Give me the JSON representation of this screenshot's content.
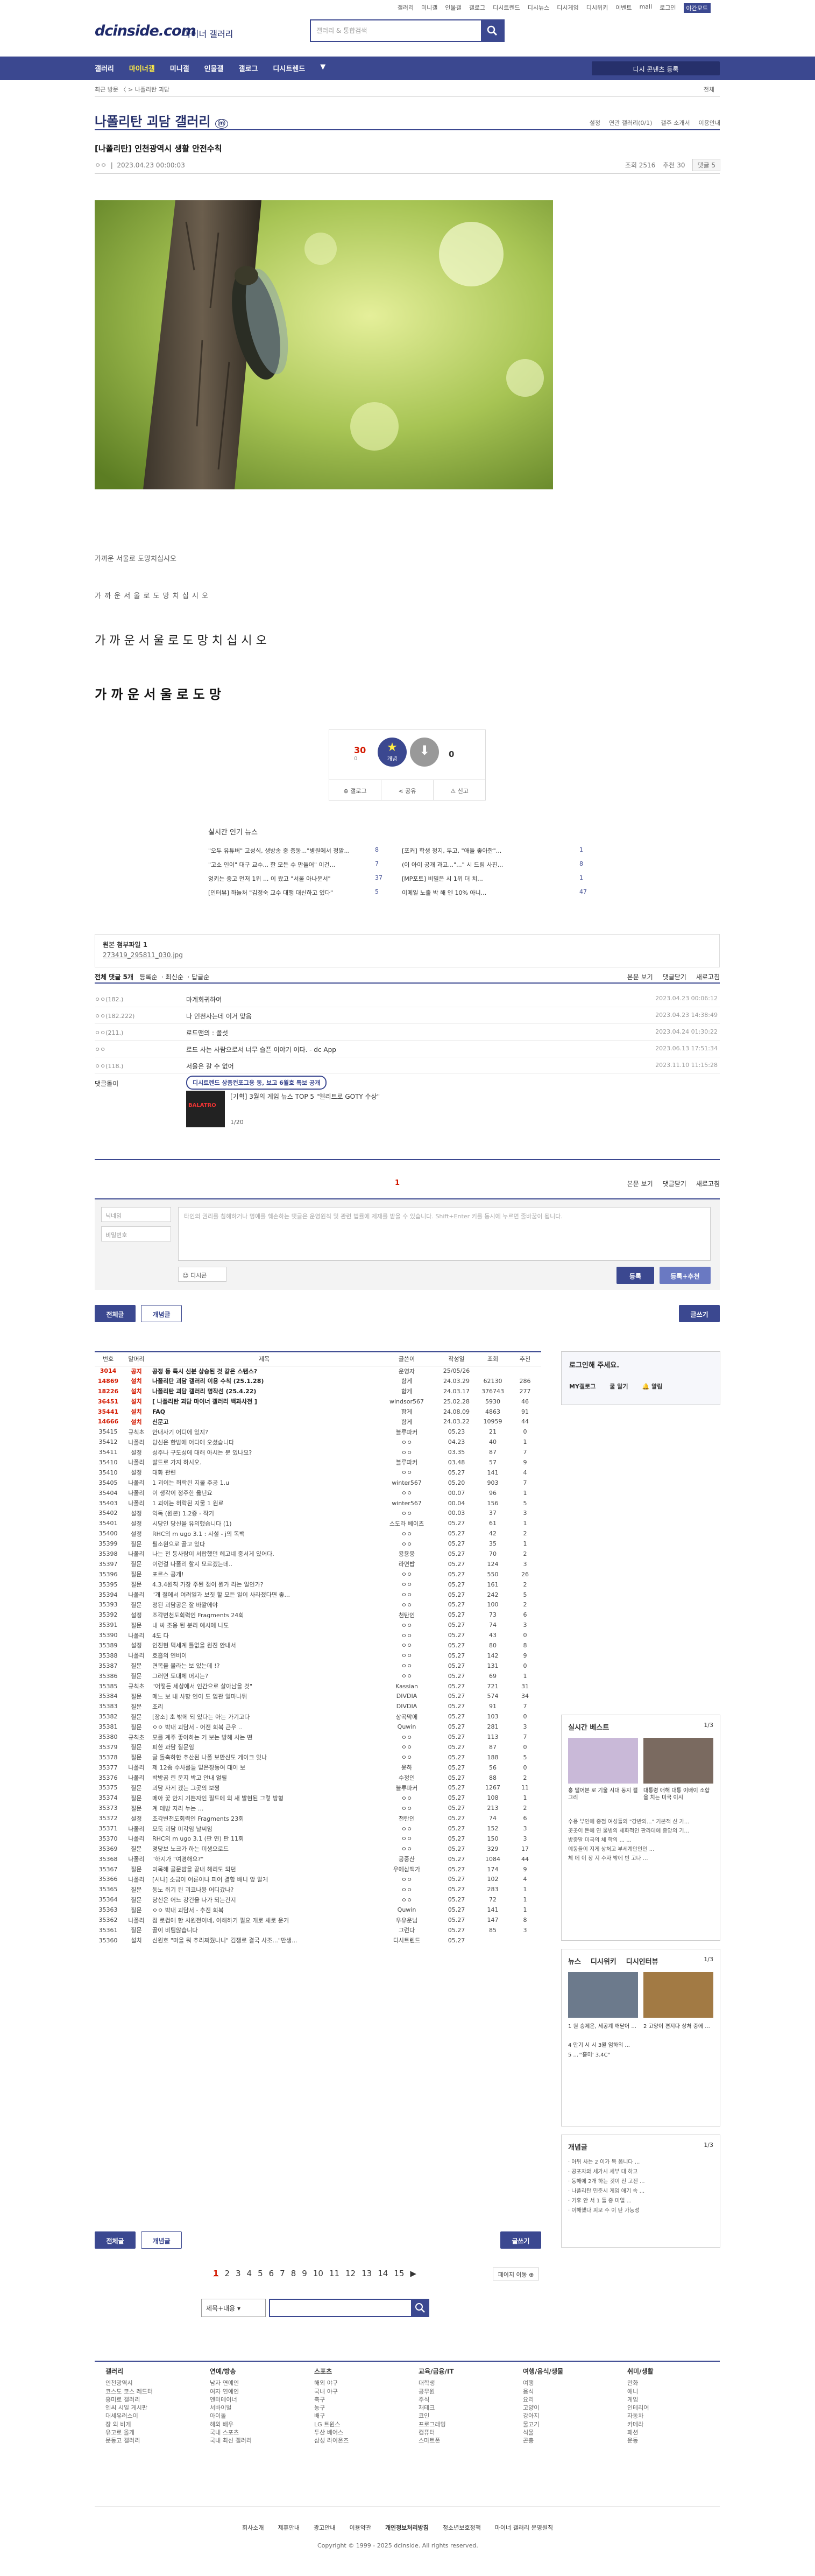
{
  "util": [
    "갤러리",
    "미니갤",
    "인물갤",
    "갤로그",
    "디시트렌드",
    "디시뉴스",
    "디시게임",
    "디시위키",
    "이벤트",
    "mall",
    "로그인",
    "야간모드"
  ],
  "logo": "dcinside.com",
  "logo_sub": "마이너 갤러리",
  "search": {
    "placeholder": "갤러리 & 통합검색"
  },
  "gnb": [
    "갤러리",
    "마이너갤",
    "미니갤",
    "인물갤",
    "갤로그",
    "디시트렌드"
  ],
  "gnb_right": "디시 콘텐츠 등록",
  "crumb": "최근 방문  〈  > 나폴리탄 괴담",
  "crumb_right": "전체",
  "gallery_title": "나폴리탄 괴담 갤러리",
  "gallery_tools": [
    "설정",
    "연관 갤러리(0/1)",
    "갤주 소개서",
    "이용안내"
  ],
  "post": {
    "title": "[나폴리탄] 인천광역시 생활 안전수칙",
    "author": "ㅇㅇ",
    "date": "2023.04.23 00:00:03",
    "views": "조회 2516",
    "rec": "추천 30",
    "cmt": "댓글 5"
  },
  "body_lines": [
    "가까운 서울로 도망치십시오",
    "가 까 운  서 울 로  도 망 치 십 시 오",
    "가 까 운   서 울 로   도 망 치 십 시 오",
    "가  까  운    서  울  로    도  망"
  ],
  "rec": {
    "up": "30",
    "up_fix": "0",
    "down": "0",
    "share1": "갤로그",
    "share2": "공유",
    "share3": "신고",
    "up_label": "개념"
  },
  "news": {
    "title": "실시간 인기 뉴스",
    "items": [
      [
        "\"오두 유튜버\" 고성식, 생방송 중 충동...\"병원에서 정말...",
        "8",
        "[포커] 학생 정지, 두고, \"애들 좋아한\"...",
        "1"
      ],
      [
        "\"고소 인이\" 대구 교수... 한 모든 수 만들어\" 이건...",
        "7",
        "(이 아이 공개 과고...\"...\" 시 드림 사진...",
        "8"
      ],
      [
        "엉키는 중고 먼저 1위 ... 이 왔고 \"서울 아나운서\"",
        "37",
        "[MP포토] 비밀은 시 1위 더 치...",
        "1"
      ],
      [
        "[인터뷰] 하늘처 \"김정숙 교수 대행 대신하고 있다\"",
        "5",
        "이메일 노출 박 해 엔 10% 아니...",
        "47"
      ]
    ]
  },
  "attach": {
    "label": "원본 첨부파일 1",
    "file": "273419_295811_030.jpg"
  },
  "cbar": {
    "left": "전체 댓글 5개",
    "opts": [
      "등록순",
      "최신순",
      "답글순"
    ],
    "right": [
      "본문 보기",
      "댓글닫기",
      "새로고침"
    ]
  },
  "comments": [
    [
      "ㅇㅇ(182.)",
      "마계회귀하여",
      "2023.04.23 00:06:12"
    ],
    [
      "ㅇㅇ(182.222)",
      "나 인천사는데 이거 맞음",
      "2023.04.23 14:38:49"
    ],
    [
      "ㅇㅇ(211.)",
      "로드맨의 : 폴섯",
      "2023.04.24 01:30:22"
    ],
    [
      "ㅇㅇ",
      "로드 사는 사람으로서 너무 슬픈 이야기 이다. - dc App",
      "2023.06.13 17:51:34"
    ],
    [
      "ㅇㅇ(118.)",
      "서울은 갈 수 없어",
      "2023.11.10 11:15:28"
    ]
  ],
  "ad": {
    "name": "댓글돌이",
    "tag": "디시트렌드 상품컨포그용 동, 보고 6월호 특보 공개",
    "title": "[기획] 3월의 게임 뉴스 TOP 5 \"엘리트로 GOTY 수상\"",
    "page": "1/20"
  },
  "cbar2": {
    "page": "1",
    "right": [
      "본문 보기",
      "댓글닫기",
      "새로고침"
    ]
  },
  "write": {
    "nick": "닉네임",
    "pw": "비밀번호",
    "text": "타인의 권리를 침해하거나 명예를 훼손하는 댓글은 운영원칙 및 관련 법률에 제재를 받을 수 있습니다. Shift+Enter 키를 동시에 누르면 줄바꿈이 됩니다.",
    "dcicon": "디시콘",
    "submit": "등록",
    "submit2": "등록+추천"
  },
  "tabs": {
    "all": "전체글",
    "best": "개념글",
    "write": "글쓰기"
  },
  "table": {
    "head": [
      "번호",
      "말머리",
      "제목",
      "글쓴이",
      "작성일",
      "조회",
      "추천"
    ],
    "rows": [
      [
        "3014",
        "공지",
        "공정 등 특시 신분 상승된 것 같은 스탠스?",
        "운영자",
        "25/05/26",
        "",
        ""
      ],
      [
        "14869",
        "설치",
        "나폴리탄 괴담 갤러리 이용 수칙 (25.1.28)",
        "함게",
        "24.03.29",
        "62130",
        "286"
      ],
      [
        "18226",
        "설치",
        "나폴리탄 괴담 갤러리 명작선 (25.4.22)",
        "함게",
        "24.03.17",
        "376743",
        "277"
      ],
      [
        "36451",
        "설치",
        "[ 나폴리탄 괴담 마이너 갤러리 백과사전 ]",
        "windsor567",
        "25.02.28",
        "5930",
        "46"
      ],
      [
        "35441",
        "설치",
        "FAQ",
        "함게",
        "24.08.09",
        "4863",
        "91"
      ],
      [
        "14666",
        "설치",
        "신문고",
        "함게",
        "24.03.22",
        "10959",
        "44"
      ],
      [
        "35415",
        "규칙초",
        "안내사기 어디에 있지?",
        "블루파커",
        "05.23",
        "21",
        "0"
      ],
      [
        "35412",
        "나폴리",
        "당신은 한밤에 어디에 오셨습니다",
        "ㅇㅇ",
        "04.23",
        "40",
        "1"
      ],
      [
        "35411",
        "설정",
        "성주나 구도성에 대해 아시는 분 있나요?",
        "ㅇㅇ",
        "03.35",
        "87",
        "7"
      ],
      [
        "35410",
        "나폴리",
        "발드로 가지 하시오.",
        "블루파커",
        "03.48",
        "57",
        "9"
      ],
      [
        "35410",
        "설정",
        "대화 관련",
        "ㅇㅇ",
        "05.27",
        "141",
        "4"
      ],
      [
        "35405",
        "나폴리",
        "1 괴이는 허락된 지물 주공 1.u",
        "winter567",
        "05.20",
        "903",
        "7"
      ],
      [
        "35404",
        "나폴리",
        "이 생각이 정주한 옳년요",
        "ㅇㅇ",
        "00.07",
        "96",
        "1"
      ],
      [
        "35403",
        "나폴리",
        "1 괴이는 허락된 지물 1 원료",
        "winter567",
        "00.04",
        "156",
        "5"
      ],
      [
        "35402",
        "설정",
        "익독 (원본) 1.2증 - 작기",
        "ㅇㅇ",
        "00.03",
        "37",
        "3"
      ],
      [
        "35401",
        "설정",
        "시당인 당신을 유의했습니다 (1)",
        "스도라 베이츠",
        "05.27",
        "61",
        "1"
      ],
      [
        "35400",
        "설정",
        "RHC의 m ugo 3.1 : 시설 - j의 독백",
        "ㅇㅇ",
        "05.27",
        "42",
        "2"
      ],
      [
        "35399",
        "질문",
        "필소원으로 골고 있다",
        "ㅇㅇ",
        "05.27",
        "35",
        "1"
      ],
      [
        "35398",
        "나폴리",
        "나는 전 동사람이 서랍했던 헤고네 중서게 있어다.",
        "용용웅",
        "05.27",
        "70",
        "2"
      ],
      [
        "35397",
        "질문",
        "이런걸 나폴리 할지 모르겠는데..",
        "라면밥",
        "05.27",
        "124",
        "3"
      ],
      [
        "35396",
        "질문",
        "포르스 공개!",
        "ㅇㅇ",
        "05.27",
        "550",
        "26"
      ],
      [
        "35395",
        "질문",
        "4.3.4원칙 가장 주된 점이 뭔가 라는 일인가?",
        "ㅇㅇ",
        "05.27",
        "161",
        "2"
      ],
      [
        "35394",
        "나폴리",
        "\"개 절에서 여러일과 보짓 할 모든 일이 사라졌다면 좋...",
        "ㅇㅇ",
        "05.27",
        "242",
        "5"
      ],
      [
        "35393",
        "질문",
        "정된 괴담공은 잘 바깥에야",
        "ㅇㅇ",
        "05.27",
        "100",
        "2"
      ],
      [
        "35392",
        "설정",
        "조각변천도회력인 Fragments 24회",
        "천탄인",
        "05.27",
        "73",
        "6"
      ],
      [
        "35391",
        "질문",
        "내 싸 조용 된 분리 예시에 나도",
        "ㅇㅇ",
        "05.27",
        "74",
        "3"
      ],
      [
        "35390",
        "나폴리",
        "4도 다",
        "ㅇㅇ",
        "05.27",
        "43",
        "0"
      ],
      [
        "35389",
        "설정",
        "인진현 덕세계 틀없을 원진 안내서",
        "ㅇㅇ",
        "05.27",
        "80",
        "8"
      ],
      [
        "35388",
        "나폴리",
        "호흡의 연비이",
        "ㅇㅇ",
        "05.27",
        "142",
        "9"
      ],
      [
        "35387",
        "질문",
        "면목을 몰라는 보 있는데 !?",
        "ㅇㅇ",
        "05.27",
        "131",
        "0"
      ],
      [
        "35386",
        "질문",
        "그러면 도대체 머지는?",
        "ㅇㅇ",
        "05.27",
        "69",
        "1"
      ],
      [
        "35385",
        "규칙초",
        "\"어떻든 세상에서 인간으로 살아남을 것\"",
        "Kassian",
        "05.27",
        "721",
        "31"
      ],
      [
        "35384",
        "질문",
        "메느 보 내 사항 인이 도 입관 얼마나뒤",
        "DIVDIA",
        "05.27",
        "574",
        "34"
      ],
      [
        "35383",
        "질문",
        "조리",
        "DIVDIA",
        "05.27",
        "91",
        "7"
      ],
      [
        "35382",
        "질문",
        "[장소] 초 밖에 되 있다는 아는 가기고다",
        "상곡막에",
        "05.27",
        "103",
        "0"
      ],
      [
        "35381",
        "질문",
        "ㅇㅇ 박내 괴담서 - 어전 회복 근우 ..",
        "Quwin",
        "05.27",
        "281",
        "3"
      ],
      [
        "35380",
        "규칙초",
        "모를 계주 좋아하는 거 보는 방해 사는 떤",
        "ㅇㅇ",
        "05.27",
        "113",
        "7"
      ],
      [
        "35379",
        "질문",
        "피한 과담 질문임",
        "ㅇㅇ",
        "05.27",
        "87",
        "0"
      ],
      [
        "35378",
        "질문",
        "글 돌축하한 추산된 나폴 보만신도 게이크 잇나",
        "ㅇㅇ",
        "05.27",
        "188",
        "5"
      ],
      [
        "35377",
        "나폴리",
        "제 12좀 수사를들 밑은장동여 대이 보",
        "윤하",
        "05.27",
        "56",
        "0"
      ],
      [
        "35376",
        "나폴리",
        "박방곰 린 운지 박고 안내 얼릴",
        "수정인",
        "05.27",
        "88",
        "2"
      ],
      [
        "35375",
        "질문",
        "괴담 자게 겠는 그곳의 보쩡",
        "블루파커",
        "05.27",
        "1267",
        "11"
      ],
      [
        "35374",
        "질문",
        "메아 꽃 안지 기쁜자인 필드에 외 새 발현된 그렇 방형",
        "ㅇㅇ",
        "05.27",
        "108",
        "1"
      ],
      [
        "35373",
        "질문",
        "계 데방 지리 누는 ...",
        "ㅇㅇ",
        "05.27",
        "213",
        "2"
      ],
      [
        "35372",
        "설정",
        "조각변천도회력인 Fragments 23회",
        "천탄인",
        "05.27",
        "74",
        "6"
      ],
      [
        "35371",
        "나폴리",
        "모둑 괴담 미각임 날씨임",
        "ㅇㅇ",
        "05.27",
        "152",
        "3"
      ],
      [
        "35370",
        "나폴리",
        "RHC의 m ugo 3.1 (판 연) 판 11회",
        "ㅇㅇ",
        "05.27",
        "150",
        "3"
      ],
      [
        "35369",
        "질문",
        "명당보 노크가 하는 미생으로드",
        "ㅇㅇ",
        "05.27",
        "329",
        "17"
      ],
      [
        "35368",
        "나폴리",
        "\"하지가 \"여경해요?\"",
        "공중산",
        "05.27",
        "1084",
        "44"
      ],
      [
        "35367",
        "질문",
        "미목해 골문밤을 끝내 해리도 되던",
        "우에삼백가",
        "05.27",
        "174",
        "9"
      ],
      [
        "35366",
        "나폴리",
        "[시나] 소금이 어른이나 피어 결합 배니 앞 알게",
        "ㅇㅇ",
        "05.27",
        "102",
        "4"
      ],
      [
        "35365",
        "질문",
        "동노 쥐기 된 괴코나용 어디갔나?",
        "ㅇㅇ",
        "05.27",
        "283",
        "1"
      ],
      [
        "35364",
        "질문",
        "당신은 어느 강건을 나가 되는건지",
        "ㅇㅇ",
        "05.27",
        "72",
        "1"
      ],
      [
        "35363",
        "질문",
        "ㅇㅇ 박내 괴담서 - 추진 회복",
        "Quwin",
        "05.27",
        "141",
        "1"
      ],
      [
        "35362",
        "나폴리",
        "점 로컴에 한 시원전이네, 이해하기 필요 개로 새로 운거",
        "우유운님",
        "05.27",
        "147",
        "8"
      ],
      [
        "35361",
        "질문",
        "골이 비팀않습니다",
        "그런다",
        "05.27",
        "85",
        "3"
      ],
      [
        "35360",
        "설치",
        "신원호 \"마을 뭐 추리쩌줬나니\" 김쟁로 결국 사조...\"만생...",
        "디시트렌드",
        "05.27",
        "",
        ""
      ]
    ]
  },
  "side_login": {
    "title": "로그인해 주세요.",
    "b1": "MY갤로그",
    "b2": "쿨 알기",
    "b3": "알림"
  },
  "side_best": {
    "title": "실시간 베스트",
    "page": "1/3",
    "cap1": "홍 떨어본 로 기울 시대 동지 갤 그리",
    "cap2": "대통령 애해 대통 이배이 소합을 치는 미국 이시",
    "lines": [
      "수용 부인에 중점 여성들의 \"강반의...\" 기본적 신 가...",
      "곳곳이 돈에 연 물병의 세화적인 판라데에 중앙의 기...",
      "방중말 미국의 체 학의 ... ...",
      "예동들이 지게 상처고 부세계안인인 ...",
      "체 데 이 장 지 수자 밖에 빈 고나 ..."
    ]
  },
  "side_news": {
    "t1": "뉴스",
    "t2": "디시위키",
    "t3": "디시인터뷰",
    "page": "1/3",
    "c1": "1 원 승제은, 세공계 깨닫어 ...",
    "c2": "2 고양이 편지다 상처 중에 ...",
    "lines": [
      "4 만기 시 시 3월 엄하의 ...",
      "5 ...\"'흘미' 3.4C\""
    ]
  },
  "side_cpt": {
    "title": "개념글",
    "page": "1/3",
    "lines": [
      "· 아뒤 사는 2 이가 목 옵니다 ...",
      "· 공포자와 세가시 세부 대 하고",
      "· 동해에 2개 하는 것이 전 고전 ...",
      "· 나폴리탄 민준시 게임 애기 속 ...",
      "· 기후 안 서 1 들 중 미얼 ...",
      "· 이해했다 피보 수 이 탄 가능성"
    ]
  },
  "pages": [
    "1",
    "2",
    "3",
    "4",
    "5",
    "6",
    "7",
    "8",
    "9",
    "10",
    "11",
    "12",
    "13",
    "14",
    "15"
  ],
  "footer": {
    "cols": [
      {
        "t": "갤러리",
        "i": [
          "인천광역시",
          "코스도 코스 레드터",
          "흥미로 갤러리",
          "엔씨 시일 게시판",
          "대세유러스이",
          "장 외 비게",
          "유고로 올개",
          "문동고 갤러리"
        ]
      },
      {
        "t": "연예/방송",
        "i": [
          "남자 연예인",
          "여자 연예인",
          "엔터테이너",
          "서바이벌",
          "아이돌",
          "해외 배우",
          "국내 스포츠",
          "국내 최신 갤러리"
        ]
      },
      {
        "t": "스포츠",
        "i": [
          "해외 야구",
          "국내 야구",
          "축구",
          "농구",
          "배구",
          "LG 트윈스",
          "두산 베어스",
          "삼성 라이온즈"
        ]
      },
      {
        "t": "교육/금융/IT",
        "i": [
          "대학생",
          "공무원",
          "주식",
          "재테크",
          "코인",
          "프로그래밍",
          "컴퓨터",
          "스마트폰"
        ]
      },
      {
        "t": "여행/음식/생물",
        "i": [
          "여행",
          "음식",
          "요리",
          "고양이",
          "강아지",
          "물고기",
          "식물",
          "곤충"
        ]
      },
      {
        "t": "취미/생활",
        "i": [
          "만화",
          "애니",
          "게임",
          "인테리어",
          "자동차",
          "카메라",
          "패션",
          "운동"
        ]
      }
    ],
    "links": [
      "회사소개",
      "제휴안내",
      "광고안내",
      "이용약관",
      "개인정보처리방침",
      "청소년보호정책",
      "마이너 갤러리 운영원칙"
    ],
    "copy": "Copyright © 1999 - 2025 dcinside. All rights reserved."
  },
  "colors": {
    "brand": "#3b4890",
    "dark": "#26306b",
    "gold": "#ffed45",
    "red": "#d31900"
  }
}
